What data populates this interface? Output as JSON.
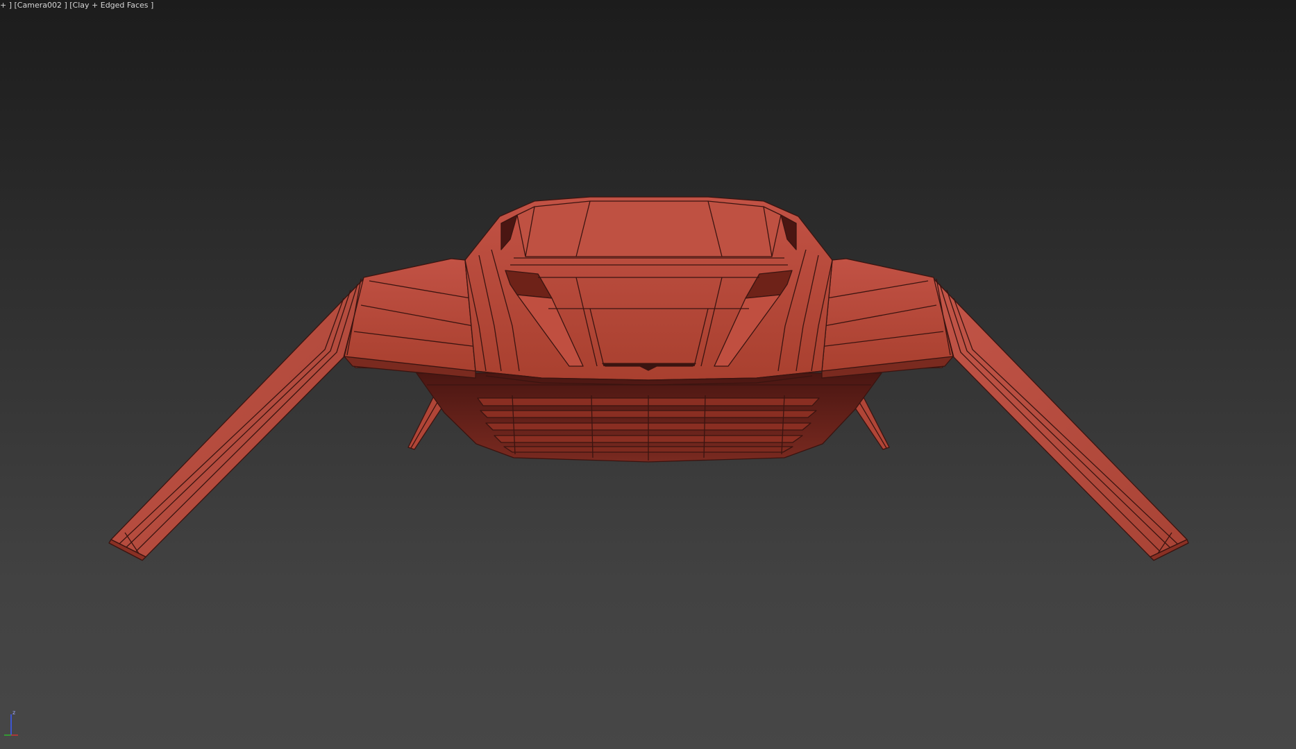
{
  "viewport": {
    "label_prefix": "+ ]",
    "camera_label": "[Camera002 ]",
    "shading_label": "[Clay + Edged Faces ]"
  },
  "model": {
    "name": "vehicle-front-view",
    "fill_color": "#b94a3e",
    "edge_color": "#3a1410",
    "shadow_color": "#5a1c15"
  },
  "axis_gizmo": {
    "z_label": "z"
  }
}
